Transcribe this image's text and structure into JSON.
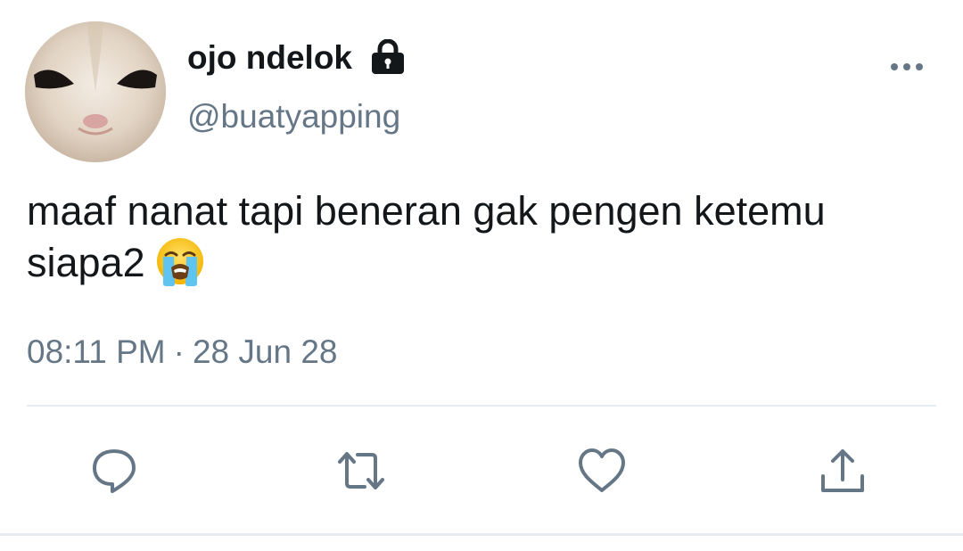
{
  "tweet": {
    "author": {
      "display_name": "ojo ndelok",
      "handle": "@buatyapping",
      "protected": true
    },
    "text": "maaf nanat tapi beneran gak pengen ketemu siapa2",
    "emoji": "loudly-crying-face",
    "time": "08:11 PM",
    "separator": "·",
    "date": "28 Jun 28"
  },
  "actions": [
    {
      "name": "reply",
      "icon": "reply-icon"
    },
    {
      "name": "retweet",
      "icon": "retweet-icon"
    },
    {
      "name": "like",
      "icon": "heart-icon"
    },
    {
      "name": "share",
      "icon": "share-icon"
    }
  ],
  "colors": {
    "text": "#14171a",
    "secondary": "#657786",
    "divider": "#e6ecf0"
  }
}
